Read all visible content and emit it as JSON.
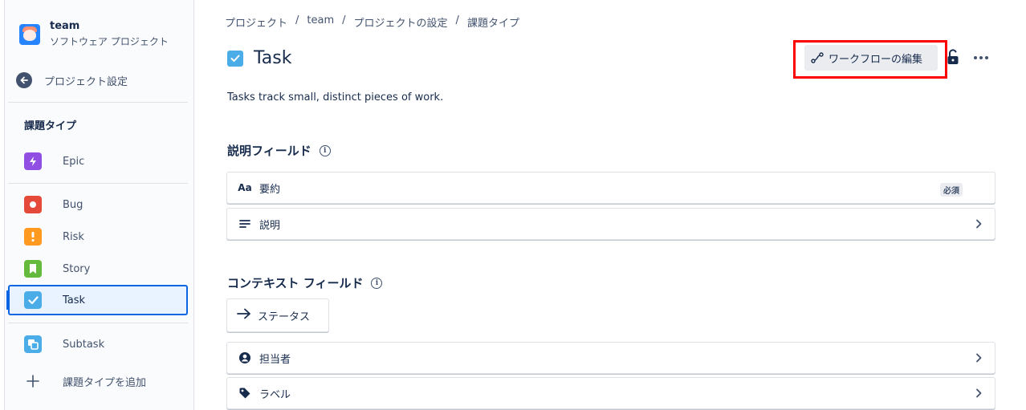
{
  "sidebar": {
    "project_name": "team",
    "project_type": "ソフトウェア プロジェクト",
    "back_label": "プロジェクト設定",
    "section_heading": "課題タイプ",
    "items": [
      {
        "label": "Epic",
        "color": "#904ee2",
        "icon": "lightning-icon"
      },
      {
        "label": "Bug",
        "color": "#e5493a",
        "icon": "bug-icon"
      },
      {
        "label": "Risk",
        "color": "#ff991f",
        "icon": "risk-icon"
      },
      {
        "label": "Story",
        "color": "#63ba3c",
        "icon": "story-icon"
      },
      {
        "label": "Task",
        "color": "#4bade8",
        "icon": "task-icon"
      },
      {
        "label": "Subtask",
        "color": "#4bade8",
        "icon": "subtask-icon"
      }
    ],
    "add_label": "課題タイプを追加"
  },
  "breadcrumb": [
    "プロジェクト",
    "team",
    "プロジェクトの設定",
    "課題タイプ"
  ],
  "page": {
    "title": "Task",
    "description": "Tasks track small, distinct pieces of work.",
    "workflow_button": "ワークフローの編集"
  },
  "description_fields": {
    "title": "説明フィールド",
    "fields": [
      {
        "icon": "text-icon",
        "glyph": "Aa",
        "label": "要約",
        "badge": "必須"
      },
      {
        "icon": "lines-icon",
        "label": "説明"
      }
    ]
  },
  "context_fields": {
    "title": "コンテキスト フィールド",
    "status_label": "ステータス",
    "fields": [
      {
        "icon": "user-icon",
        "label": "担当者"
      },
      {
        "icon": "tag-icon",
        "label": "ラベル"
      }
    ]
  }
}
